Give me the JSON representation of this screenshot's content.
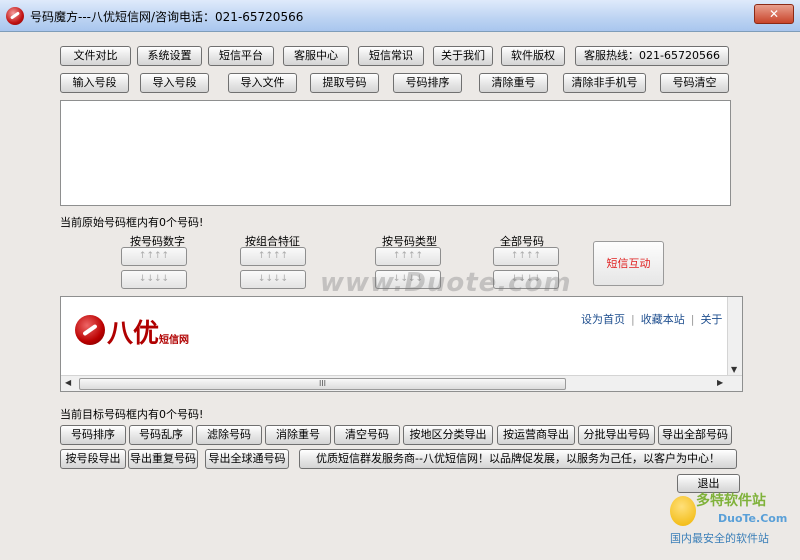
{
  "window": {
    "title": "号码魔方---八优短信网/咨询电话：021-65720566",
    "close_label": "✕"
  },
  "toolbar1": [
    "文件对比",
    "系统设置",
    "短信平台",
    "客服中心",
    "短信常识",
    "关于我们",
    "软件版权",
    "客服热线：021-65720566"
  ],
  "toolbar2": [
    "输入号段",
    "导入号段",
    "导入文件",
    "提取号码",
    "号码排序",
    "清除重号",
    "清除非手机号",
    "号码清空"
  ],
  "status": {
    "source_count_text": "当前原始号码框内有0个号码!",
    "target_count_text": "当前目标号码框内有0个号码!"
  },
  "filters": {
    "by_digits": "按号码数字",
    "by_combo": "按组合特征",
    "by_type": "按号码类型",
    "all": "全部号码",
    "placeholder": "↑↑↑↑",
    "placeholder2": "↓↓↓↓"
  },
  "sms_interact_label": "短信互动",
  "browser": {
    "brand_name": "八优",
    "brand_sub": "短信网",
    "link_home": "设为首页",
    "link_fav": "收藏本站",
    "link_about": "关于",
    "sep": "|",
    "hscroll_grip": "III"
  },
  "watermark_center": "www.Duote.com",
  "actions1": [
    "号码排序",
    "号码乱序",
    "滤除号码",
    "消除重号",
    "清空号码",
    "按地区分类导出",
    "按运营商导出",
    "分批导出号码",
    "导出全部号码"
  ],
  "actions2": [
    "按号段导出",
    "导出重复号码",
    "导出全球通号码"
  ],
  "slogan": "优质短信群发服务商--八优短信网！以品牌促发展，以服务为己任，以客户为中心！",
  "exit_label": "退出",
  "corner_watermark": {
    "logo": "多特软件站",
    "site": "DuoTe.Com",
    "slogan": "国内最安全的软件站"
  },
  "colors": {
    "accent_red": "#b00000",
    "titlebar": "#bcd3f2"
  }
}
